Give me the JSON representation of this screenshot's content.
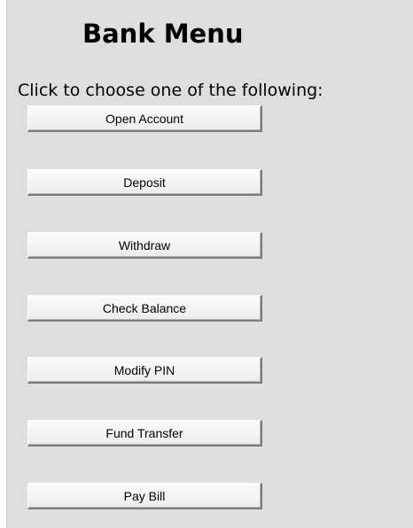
{
  "header": {
    "title": "Bank Menu"
  },
  "instructions": "Click to choose one of the following:",
  "menu": {
    "buttons": [
      {
        "id": "open-account",
        "label": "Open Account"
      },
      {
        "id": "deposit",
        "label": "Deposit"
      },
      {
        "id": "withdraw",
        "label": "Withdraw"
      },
      {
        "id": "check-balance",
        "label": "Check Balance"
      },
      {
        "id": "modify-pin",
        "label": "Modify PIN"
      },
      {
        "id": "fund-transfer",
        "label": "Fund Transfer"
      },
      {
        "id": "pay-bill",
        "label": "Pay Bill"
      }
    ]
  },
  "colors": {
    "panel_background": "#dedede",
    "button_face": "#f4f4f4",
    "button_shadow": "#7a7a7a",
    "text": "#000000"
  }
}
